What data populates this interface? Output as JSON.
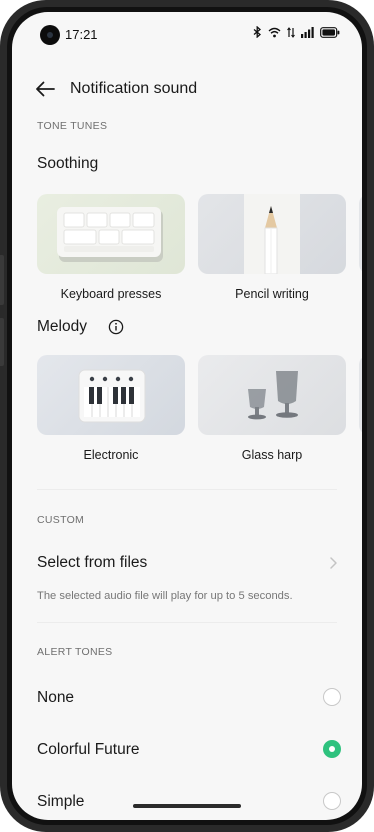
{
  "status_bar": {
    "time": "17:21",
    "icons": [
      "bluetooth-icon",
      "wifi-icon",
      "mobile-data-icon",
      "signal-icon",
      "battery-icon"
    ]
  },
  "header": {
    "back_icon": "back-arrow-icon",
    "title": "Notification sound"
  },
  "tone_tunes": {
    "section_label": "TONE TUNES",
    "soothing": {
      "title": "Soothing",
      "items": [
        {
          "label": "Keyboard presses",
          "thumb": "keyboard"
        },
        {
          "label": "Pencil writing",
          "thumb": "pencil"
        }
      ]
    },
    "melody": {
      "title": "Melody",
      "info_icon": "info-icon",
      "items": [
        {
          "label": "Electronic",
          "thumb": "piano"
        },
        {
          "label": "Glass harp",
          "thumb": "glasses"
        }
      ]
    }
  },
  "custom": {
    "section_label": "CUSTOM",
    "select_label": "Select from files",
    "hint": "The selected audio file will play for up to 5 seconds."
  },
  "alert_tones": {
    "section_label": "ALERT TONES",
    "items": [
      {
        "label": "None",
        "selected": false
      },
      {
        "label": "Colorful Future",
        "selected": true
      },
      {
        "label": "Simple",
        "selected": false
      }
    ]
  },
  "colors": {
    "accent": "#2ec27e",
    "background": "#f7f7f7",
    "text": "#1a1a1a",
    "secondary_text": "#6f6f6f"
  }
}
